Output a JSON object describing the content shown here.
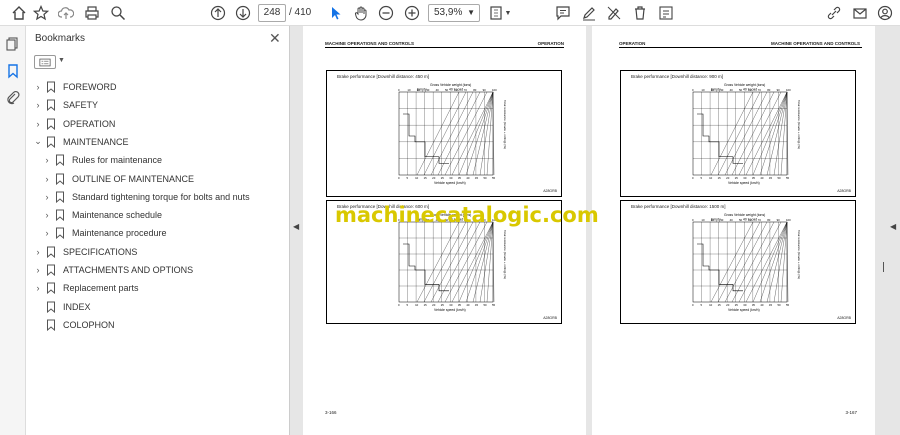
{
  "toolbar": {
    "page_current": "248",
    "page_total": "/ 410",
    "zoom": "53,9%"
  },
  "bookmarks_panel": {
    "title": "Bookmarks",
    "items": [
      {
        "label": "FOREWORD",
        "level": 0,
        "expander": "›"
      },
      {
        "label": "SAFETY",
        "level": 0,
        "expander": "›"
      },
      {
        "label": "OPERATION",
        "level": 0,
        "expander": "›"
      },
      {
        "label": "MAINTENANCE",
        "level": 0,
        "expander": "⌄"
      },
      {
        "label": "Rules for maintenance",
        "level": 1,
        "expander": "›"
      },
      {
        "label": "OUTLINE OF MAINTENANCE",
        "level": 1,
        "expander": "›"
      },
      {
        "label": "Standard tightening torque for bolts and nuts",
        "level": 1,
        "expander": "›"
      },
      {
        "label": "Maintenance schedule",
        "level": 1,
        "expander": "›"
      },
      {
        "label": "Maintenance procedure",
        "level": 1,
        "expander": "›"
      },
      {
        "label": "SPECIFICATIONS",
        "level": 0,
        "expander": "›"
      },
      {
        "label": "ATTACHMENTS AND OPTIONS",
        "level": 0,
        "expander": "›"
      },
      {
        "label": "Replacement parts",
        "level": 0,
        "expander": "›"
      },
      {
        "label": "INDEX",
        "level": 0,
        "expander": ""
      },
      {
        "label": "COLOPHON",
        "level": 0,
        "expander": ""
      }
    ]
  },
  "pages": {
    "left": {
      "header_left": "MACHINE OPERATIONS AND CONTROLS",
      "header_right": "OPERATION",
      "page_number": "3-166",
      "graphs": [
        {
          "caption": "Brake performance [Downhill distance: 450 m]",
          "code": "A28GRB"
        },
        {
          "caption": "Brake performance [Downhill distance: 600 m]",
          "code": "A28GRB"
        }
      ]
    },
    "right": {
      "header_left": "OPERATION",
      "header_right": "MACHINE OPERATIONS AND CONTROLS",
      "page_number": "3-167",
      "graphs": [
        {
          "caption": "Brake performance [Downhill distance: 900 m]",
          "code": "A28GRB"
        },
        {
          "caption": "Brake performance [Downhill distance: 1500 m]",
          "code": "A28GRB"
        }
      ]
    }
  },
  "graph_labels": {
    "top_title": "Gross Vehicle weight (tons)",
    "empty": "Empty",
    "loaded": "40 t Load",
    "x_axis": "Vehicle speed (km/h)",
    "y_axis": "Total resistance (Grade + rolling) (%)",
    "top_ticks": [
      "0",
      "10",
      "20",
      "30",
      "40",
      "50",
      "60",
      "70",
      "80",
      "90",
      "100"
    ],
    "bottom_ticks": [
      "0",
      "5",
      "10",
      "15",
      "20",
      "25",
      "30",
      "35",
      "40",
      "45",
      "50",
      "55"
    ]
  },
  "watermark": "machinecatalogic.com"
}
